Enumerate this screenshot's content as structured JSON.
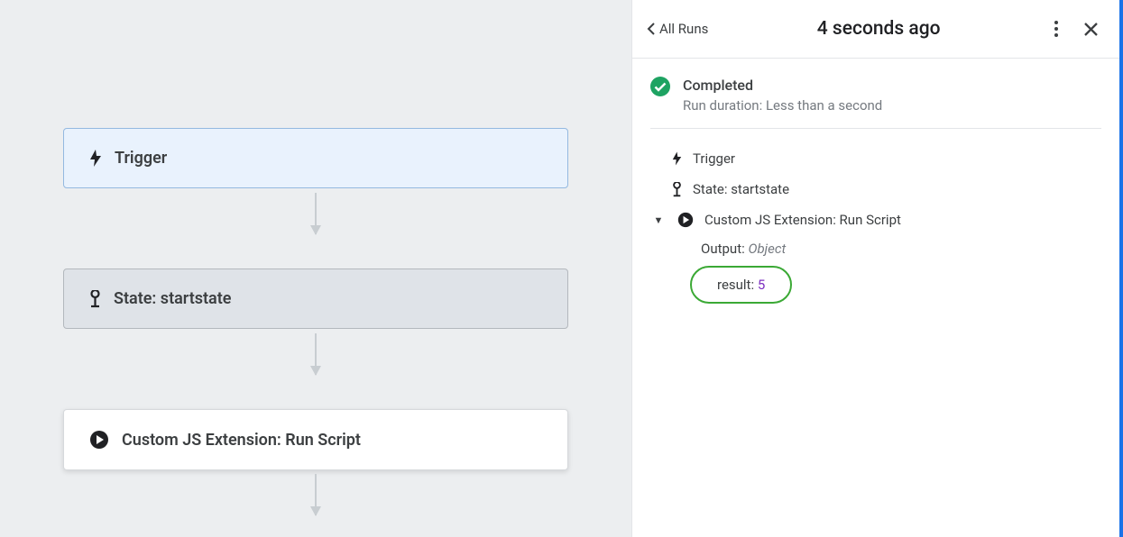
{
  "canvas": {
    "nodes": {
      "trigger": "Trigger",
      "state": "State: startstate",
      "custom": "Custom JS Extension: Run Script"
    }
  },
  "panel": {
    "back_label": "All Runs",
    "title": "4 seconds ago",
    "status": {
      "label": "Completed",
      "duration": "Run duration: Less than a second"
    },
    "steps": {
      "trigger": "Trigger",
      "state": "State: startstate",
      "custom": "Custom JS Extension: Run Script",
      "output_label": "Output: ",
      "output_type": "Object",
      "result_label": "result: ",
      "result_value": "5"
    }
  }
}
